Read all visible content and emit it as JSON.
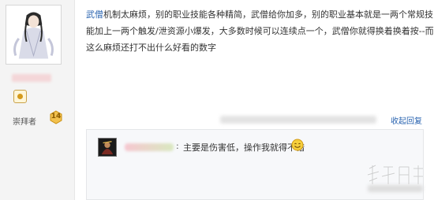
{
  "post": {
    "username": "武僧",
    "line1": "机制太麻烦，别的职业技能各种精简，武僧给你加多，别的职业基本就是一两个常规技",
    "line2": "能加上一两个触发/泄资源小爆发，大多数时候可以连续点一个，武僧你就得换着换着按--而",
    "line3": "这么麻烦还打不出什么好看的数字"
  },
  "author": {
    "rank_label": "崇拜者",
    "rank_level": "14"
  },
  "actions": {
    "collapse_label": "收起回复"
  },
  "reply": {
    "colon": ":",
    "text": "主要是伤害低，操作我就得不错"
  },
  "colors": {
    "link": "#2a64b0",
    "reply_bg": "#f7f8fa",
    "sidebar_bg": "#f4f4f4",
    "badge_gold": "#f2c14e"
  },
  "icons": {
    "author_avatar": "wuxia-character-avatar",
    "level": "level-icon",
    "rank_badge": "rank-badge-icon",
    "reply_avatar": "character-avatar",
    "emoji": "smile-icon",
    "watermark": "watermark-logo"
  }
}
